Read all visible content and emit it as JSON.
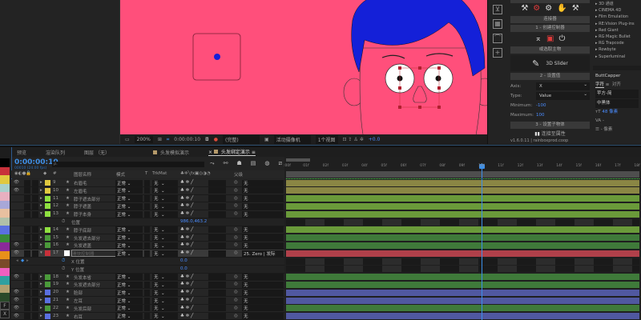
{
  "comp_toolbar": {
    "zoom": "200%",
    "time": "0:00:00:10",
    "resolution": "(完整)",
    "camera": "活动摄像机",
    "views": "1个视图",
    "exposure": "+0.0"
  },
  "plugin": {
    "title_btn": "连接器",
    "create": "1 - 创建控制器",
    "pick": "或选取主物",
    "slider": "3D Slider",
    "set_value": "2 - 设置值",
    "axis_label": "Axis:",
    "axis": "X",
    "type_label": "Type:",
    "type": "Value",
    "min_label": "Minimum:",
    "min": "-100",
    "max_label": "Maximum:",
    "max": "100",
    "set_child": "3 - 设置子物体",
    "connect": "连接至属性",
    "version": "v1.6.0.11 | rainboxprod.coop"
  },
  "effects": [
    "3D 通道",
    "CINEMA 4D",
    "Film Emulation",
    "RE:Vision Plug-ins",
    "Red Giant",
    "RG Magic Bullet",
    "RG Trapcode",
    "Rowbyte",
    "Superluminal"
  ],
  "char_panel": {
    "panel": "ButtCapper",
    "tab1": "字符",
    "tab2": "对齐",
    "font": "苹方-简",
    "style": "中黑体",
    "size": "48 像素",
    "tracking": "-",
    "leading": "- 像素"
  },
  "tabs": [
    "预览",
    "渲染队列",
    "图层 （无）",
    "头发模拟演示",
    "头发绑定演示"
  ],
  "timeline": {
    "timecode": "0:00:00:10",
    "fps": "00010 (24.00 fps)",
    "search_placeholder": "ρ.",
    "headers": {
      "num": "#",
      "name": "图层名称",
      "mode": "模式",
      "t": "T",
      "trkmat": "TrkMat",
      "parent": "父级"
    },
    "ticks": [
      ":00f",
      "01f",
      "02f",
      "03f",
      "04f",
      "05f",
      "06f",
      "07f",
      "08f",
      "09f",
      "10f",
      "11f",
      "12f",
      "13f",
      "14f",
      "15f",
      "16f",
      "17f",
      "18f"
    ],
    "current_frame": 10
  },
  "swatches": [
    "#000000",
    "#c8303a",
    "#e0c840",
    "#a8d0cc",
    "#e8b0c0",
    "#a8a8d8",
    "#e8c0a0",
    "#b0c0a8",
    "#5a70e0",
    "#3a8a3a",
    "#8a2a9a",
    "#e8901a",
    "#7a4a2a",
    "#f060c0",
    "#30a0a0",
    "#b0a070",
    "#2a4a2a"
  ],
  "swatch_letters": [
    "F",
    "X"
  ],
  "rows": [
    {
      "type": "layer",
      "num": "9",
      "name": "右眉毛",
      "label": "#e0c840",
      "eye": true,
      "mode": "正常",
      "trkmat": "无",
      "parent": "无",
      "bar": "#8a8644"
    },
    {
      "type": "layer",
      "num": "10",
      "name": "左眉毛",
      "label": "#e0c840",
      "eye": true,
      "mode": "正常",
      "trkmat": "无",
      "parent": "无",
      "bar": "#8a8644"
    },
    {
      "type": "layer",
      "num": "11",
      "name": "脖子遮去部分",
      "label": "#8fe040",
      "eye": false,
      "mode": "正常",
      "trkmat": "无",
      "parent": "无",
      "bar": "#6a9a3a"
    },
    {
      "type": "layer",
      "num": "12",
      "name": "脖子遮盖",
      "label": "#8fe040",
      "eye": false,
      "mode": "正常",
      "trkmat": "无",
      "parent": "无",
      "bar": "#6a9a3a"
    },
    {
      "type": "layer",
      "num": "13",
      "name": "脖子本身",
      "label": "#8fe040",
      "eye": false,
      "expanded": true,
      "mode": "正常",
      "trkmat": "无",
      "parent": "无",
      "bar": "#6a9a3a"
    },
    {
      "type": "prop",
      "name": "位置",
      "value": "986.0,463.2"
    },
    {
      "type": "layer",
      "num": "14",
      "name": "脖子底部",
      "label": "#8fe040",
      "eye": false,
      "mode": "正常",
      "trkmat": "无",
      "parent": "无",
      "bar": "#6a9a3a"
    },
    {
      "type": "layer",
      "num": "15",
      "name": "头发遮去部分",
      "label": "#4a9a3a",
      "eye": false,
      "mode": "正常",
      "trkmat": "无",
      "parent": "无",
      "bar": "#3f7a3a"
    },
    {
      "type": "layer",
      "num": "16",
      "name": "头发遮盖",
      "label": "#4a9a3a",
      "eye": true,
      "mode": "正常",
      "trkmat": "无",
      "parent": "无",
      "bar": "#3f7a3a"
    },
    {
      "type": "layer",
      "num": "17",
      "name": "滑块控制器",
      "label": "#c8303a",
      "eye": true,
      "selected": true,
      "expanded": true,
      "mode": "正常",
      "trkmat": "无",
      "parent": "25. Zero | 发际",
      "bar": "#b0404a"
    },
    {
      "type": "prop",
      "name": "X 位置",
      "value": "0.0",
      "keyframe_nav": true
    },
    {
      "type": "prop",
      "name": "Y 位置",
      "value": "0.0"
    },
    {
      "type": "layer",
      "num": "18",
      "name": "头发本省",
      "label": "#4a9a3a",
      "eye": true,
      "mode": "正常",
      "trkmat": "无",
      "parent": "无",
      "bar": "#3f7a3a"
    },
    {
      "type": "layer",
      "num": "19",
      "name": "头发遮去部分",
      "label": "#4a9a3a",
      "eye": false,
      "mode": "正常",
      "trkmat": "无",
      "parent": "无",
      "bar": "#3f7a3a"
    },
    {
      "type": "layer",
      "num": "20",
      "name": "脸部",
      "label": "#5a70e0",
      "eye": true,
      "mode": "正常",
      "trkmat": "无",
      "parent": "无",
      "bar": "#5058a0"
    },
    {
      "type": "layer",
      "num": "21",
      "name": "左耳",
      "label": "#5a70e0",
      "eye": true,
      "mode": "正常",
      "trkmat": "无",
      "parent": "无",
      "bar": "#5058a0"
    },
    {
      "type": "layer",
      "num": "22",
      "name": "头发后部",
      "label": "#4a9a3a",
      "eye": true,
      "mode": "正常",
      "trkmat": "无",
      "parent": "无",
      "bar": "#3f7a3a"
    },
    {
      "type": "layer",
      "num": "23",
      "name": "右耳",
      "label": "#5a70e0",
      "eye": true,
      "mode": "正常",
      "trkmat": "无",
      "parent": "无",
      "bar": "#5058a0"
    }
  ],
  "colors": {
    "canvas": "#ff4f7b",
    "hair": "#1420d8",
    "accent": "#3b8ee8"
  }
}
